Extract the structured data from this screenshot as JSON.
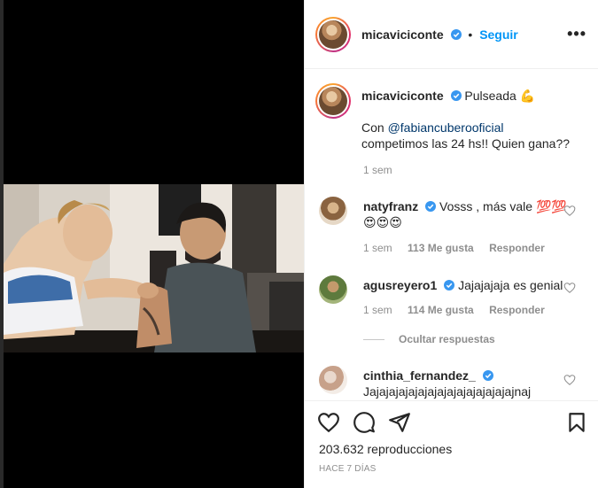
{
  "post": {
    "author": "micaviciconte",
    "follow_label": "Seguir",
    "separator": "•",
    "more_label": "•••"
  },
  "caption": {
    "author": "micaviciconte",
    "text": "Pulseada 💪",
    "mention": "@fabiancuberooficial",
    "prefix": "Con",
    "body": "competimos las 24 hs!! Quien gana??",
    "time": "1 sem"
  },
  "comments": [
    {
      "author": "natyfranz",
      "text": "Vosss , más vale 💯💯",
      "text2": "😍😍😍",
      "time": "1 sem",
      "likes": "113 Me gusta",
      "reply": "Responder"
    },
    {
      "author": "agusreyero1",
      "text": "Jajajajaja es genial",
      "time": "1 sem",
      "likes": "114 Me gusta",
      "reply": "Responder"
    },
    {
      "author": "cinthia_fernandez_",
      "text": "Jajajajajajajajajajajajajajajajnaj"
    }
  ],
  "hide_replies": "Ocultar respuestas",
  "footer": {
    "views": "203.632 reproducciones",
    "date": "HACE 7 DÍAS"
  },
  "icons": {
    "verified": "verified-badge-icon",
    "like": "heart-icon",
    "comment": "comment-bubble-icon",
    "share": "paper-plane-icon",
    "save": "bookmark-icon"
  },
  "colors": {
    "link_blue": "#0095f6",
    "verified_blue": "#3897f0",
    "meta_gray": "#8e8e8e"
  }
}
